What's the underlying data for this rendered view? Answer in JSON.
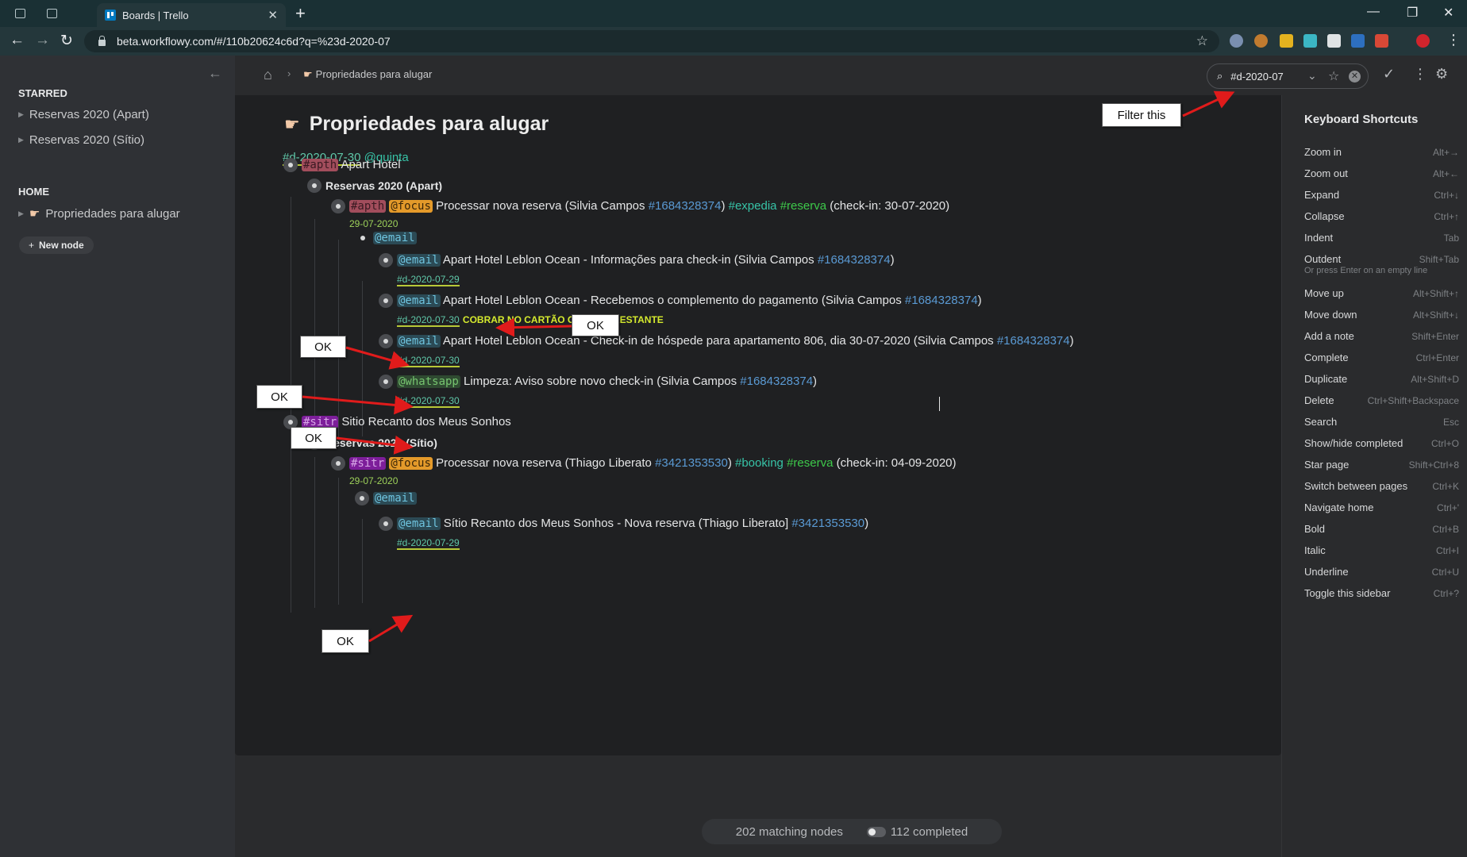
{
  "browser": {
    "tab_title": "Boards | Trello",
    "url": "beta.workflowy.com/#/110b20624c6d?q=%23d-2020-07"
  },
  "sidebar": {
    "starred_heading": "STARRED",
    "starred_items": [
      {
        "label": "Reservas 2020 (Apart)"
      },
      {
        "label": "Reservas 2020 (Sítio)"
      }
    ],
    "home_heading": "HOME",
    "home_items": [
      {
        "label": "Propriedades para alugar"
      }
    ],
    "new_node_label": "New node"
  },
  "topbar": {
    "breadcrumb": "Propriedades para alugar",
    "search_value": "#d-2020-07"
  },
  "page": {
    "title": "Propriedades para alugar",
    "title_date_tag": "#d-2020-07-30",
    "title_mention": "@quinta"
  },
  "tree": {
    "apart": {
      "tag": "#apth",
      "name": "Apart Hotel",
      "child_title": "Reservas 2020 (Apart)",
      "task": {
        "tag": "#apth",
        "focus": "@focus",
        "text_a": "Processar nova reserva (Silvia Campos",
        "id": "#1684328374",
        "text_b": ")",
        "tag_expedia": "#expedia",
        "tag_reserva": "#reserva",
        "text_c": "(check-in: 30-07-2020)",
        "date": "29-07-2020"
      },
      "email_group": "@email",
      "emails": [
        {
          "tag": "@email",
          "text": "Apart Hotel Leblon Ocean - Informações para check-in (Silvia Campos",
          "id": "#1684328374",
          "close": ")",
          "date": "#d-2020-07-29",
          "note": ""
        },
        {
          "tag": "@email",
          "text": "Apart Hotel Leblon Ocean - Recebemos o complemento do pagamento (Silvia Campos",
          "id": "#1684328374",
          "close": ")",
          "date": "#d-2020-07-30",
          "note": "COBRAR NO CARTÃO O VALOR RESTANTE"
        },
        {
          "tag": "@email",
          "text": "Apart Hotel Leblon Ocean - Check-in de hóspede para apartamento 806, dia 30-07-2020 (Silvia Campos",
          "id": "#1684328374",
          "close": ")",
          "date": "#d-2020-07-30",
          "note": ""
        }
      ],
      "whatsapp": {
        "tag": "@whatsapp",
        "text": "Limpeza: Aviso sobre novo check-in (Silvia Campos",
        "id": "#1684328374",
        "close": ")",
        "date": "#d-2020-07-30"
      }
    },
    "sitio": {
      "tag": "#sitr",
      "name": "Sitio Recanto dos Meus Sonhos",
      "child_title": "Reservas 2020 (Sítio)",
      "task": {
        "tag": "#sitr",
        "focus": "@focus",
        "text_a": "Processar nova reserva (Thiago Liberato",
        "id": "#3421353530",
        "text_b": ")",
        "tag_booking": "#booking",
        "tag_reserva": "#reserva",
        "text_c": "(check-in: 04-09-2020)",
        "date": "29-07-2020"
      },
      "email_group": "@email",
      "email": {
        "tag": "@email",
        "text": "Sítio Recanto dos Meus Sonhos - Nova reserva (Thiago Liberato]",
        "id": "#3421353530",
        "close": ")",
        "date": "#d-2020-07-29"
      }
    }
  },
  "annotations": {
    "filter_label": "Filter this",
    "ok_label": "OK",
    "arrow_color": "#e01b1b"
  },
  "footer": {
    "matching": "202 matching nodes",
    "completed": "112 completed"
  },
  "shortcuts": {
    "title": "Keyboard Shortcuts",
    "items": [
      {
        "label": "Zoom in",
        "key": "Alt+→"
      },
      {
        "label": "Zoom out",
        "key": "Alt+←"
      },
      {
        "label": "Expand",
        "key": "Ctrl+↓"
      },
      {
        "label": "Collapse",
        "key": "Ctrl+↑"
      },
      {
        "label": "Indent",
        "key": "Tab"
      },
      {
        "label": "Outdent",
        "key": "Shift+Tab"
      },
      {
        "label": "Move up",
        "key": "Alt+Shift+↑"
      },
      {
        "label": "Move down",
        "key": "Alt+Shift+↓"
      },
      {
        "label": "Add a note",
        "key": "Shift+Enter"
      },
      {
        "label": "Complete",
        "key": "Ctrl+Enter"
      },
      {
        "label": "Duplicate",
        "key": "Alt+Shift+D"
      },
      {
        "label": "Delete",
        "key": "Ctrl+Shift+Backspace"
      },
      {
        "label": "Search",
        "key": "Esc"
      },
      {
        "label": "Show/hide completed",
        "key": "Ctrl+O"
      },
      {
        "label": "Star page",
        "key": "Shift+Ctrl+8"
      },
      {
        "label": "Switch between pages",
        "key": "Ctrl+K"
      },
      {
        "label": "Navigate home",
        "key": "Ctrl+'"
      },
      {
        "label": "Bold",
        "key": "Ctrl+B"
      },
      {
        "label": "Italic",
        "key": "Ctrl+I"
      },
      {
        "label": "Underline",
        "key": "Ctrl+U"
      },
      {
        "label": "Toggle this sidebar",
        "key": "Ctrl+?"
      }
    ],
    "outdent_hint": "Or press Enter on an empty line"
  }
}
